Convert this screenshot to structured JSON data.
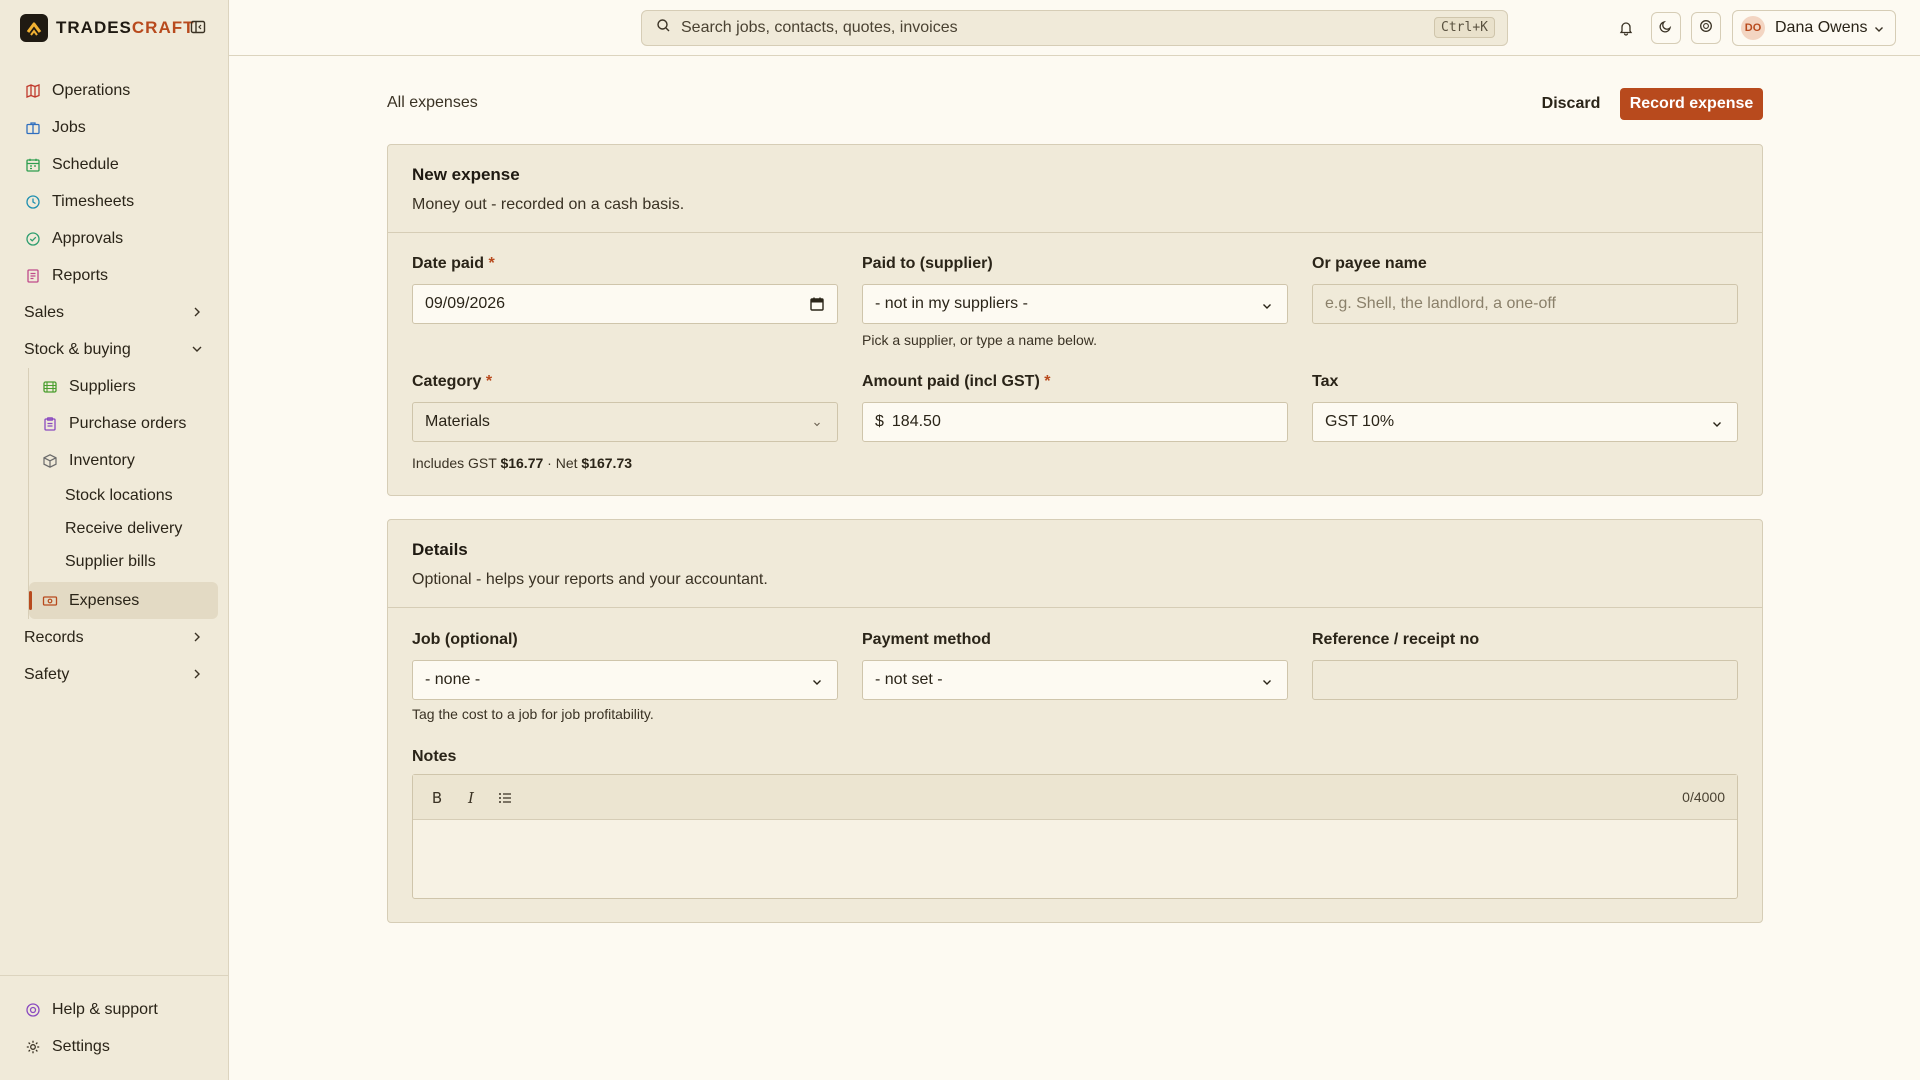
{
  "brand": {
    "name_main": "TRADES",
    "name_accent": "CRAFT"
  },
  "search": {
    "placeholder": "Search jobs, contacts, quotes, invoices",
    "shortcut": "Ctrl+K"
  },
  "user": {
    "initials": "DO",
    "name": "Dana Owens"
  },
  "sidebar": {
    "items": [
      {
        "label": "Operations",
        "icon": "map-icon",
        "color": "#c0392b"
      },
      {
        "label": "Jobs",
        "icon": "briefcase-icon",
        "color": "#2f6fbf"
      },
      {
        "label": "Schedule",
        "icon": "calendar-icon",
        "color": "#2e9e4f"
      },
      {
        "label": "Timesheets",
        "icon": "clock-icon",
        "color": "#1e8fb0"
      },
      {
        "label": "Approvals",
        "icon": "check-circle-icon",
        "color": "#2e9e6f"
      },
      {
        "label": "Reports",
        "icon": "report-icon",
        "color": "#c04a8a"
      }
    ],
    "sales": "Sales",
    "stock": "Stock & buying",
    "stock_items": [
      {
        "label": "Suppliers",
        "icon": "truck-icon",
        "color": "#4a9e2e"
      },
      {
        "label": "Purchase orders",
        "icon": "clipboard-icon",
        "color": "#8a4ac0"
      },
      {
        "label": "Inventory",
        "icon": "box-icon",
        "color": "#6a6a6a"
      }
    ],
    "inventory_items": [
      "Stock locations",
      "Receive delivery",
      "Supplier bills"
    ],
    "expenses": "Expenses",
    "records": "Records",
    "safety": "Safety",
    "help": "Help & support",
    "settings": "Settings"
  },
  "page": {
    "breadcrumb": "All expenses",
    "discard": "Discard",
    "record": "Record expense"
  },
  "new_expense": {
    "title": "New expense",
    "subtitle": "Money out - recorded on a cash basis.",
    "date_label": "Date paid",
    "date_value": "09/09/2026",
    "paid_to_label": "Paid to (supplier)",
    "paid_to_value": "- not in my suppliers -",
    "paid_to_help": "Pick a supplier, or type a name below.",
    "payee_label": "Or payee name",
    "payee_placeholder": "e.g. Shell, the landlord, a one-off",
    "category_label": "Category",
    "category_value": "Materials",
    "amount_label": "Amount paid (incl GST)",
    "currency": "$",
    "amount_value": "184.50",
    "tax_label": "Tax",
    "tax_value": "GST 10%",
    "includes_prefix": "Includes GST",
    "gst_amount": "$16.77",
    "net_prefix": "· Net",
    "net_amount": "$167.73",
    "required_marker": "*"
  },
  "details": {
    "title": "Details",
    "subtitle": "Optional - helps your reports and your accountant.",
    "job_label": "Job (optional)",
    "job_value": "- none -",
    "job_help": "Tag the cost to a job for job profitability.",
    "payment_label": "Payment method",
    "payment_value": "- not set -",
    "ref_label": "Reference / receipt no",
    "notes_label": "Notes",
    "bold": "B",
    "italic": "I",
    "counter": "0/4000"
  }
}
